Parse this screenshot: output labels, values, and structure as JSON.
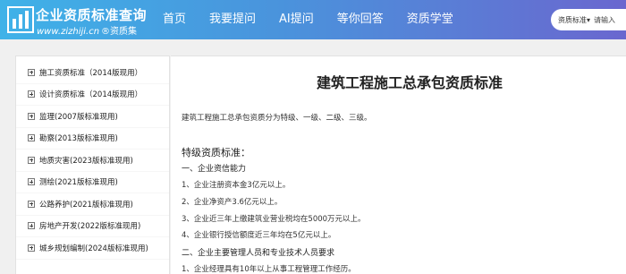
{
  "header": {
    "logo_title": "企业资质标准查询",
    "logo_url": "www.zizhiji.cn",
    "logo_tag": "®资质集",
    "nav": [
      "首页",
      "我要提问",
      "AI提问",
      "等你回答",
      "资质学堂"
    ],
    "search": {
      "select_label": "资质标准▾",
      "placeholder": "请输入"
    }
  },
  "sidebar": {
    "items": [
      "施工资质标准（2014版现用）",
      "设计资质标准（2014版现用）",
      "监理(2007版标准现用)",
      "勘察(2013版标准现用)",
      "地质灾害(2023版标准现用)",
      "测绘(2021版标准现用)",
      "公路养护(2021版标准现用)",
      "房地产开发(2022版标准现用)",
      "城乡规划编制(2024版标准现用)"
    ]
  },
  "content": {
    "title": "建筑工程施工总承包资质标准",
    "intro": "建筑工程施工总承包资质分为特级、一级、二级、三级。",
    "section_title": "特级资质标准：",
    "sub1": "一、企业资信能力",
    "lines1": [
      "1、企业注册资本金3亿元以上。",
      "2、企业净资产3.6亿元以上。",
      "3、企业近三年上缴建筑业营业税均在5000万元以上。",
      "4、企业银行授信额度近三年均在5亿元以上。"
    ],
    "sub2": "二、企业主要管理人员和专业技术人员要求",
    "lines2": [
      "1、企业经理具有10年以上从事工程管理工作经历。"
    ]
  }
}
